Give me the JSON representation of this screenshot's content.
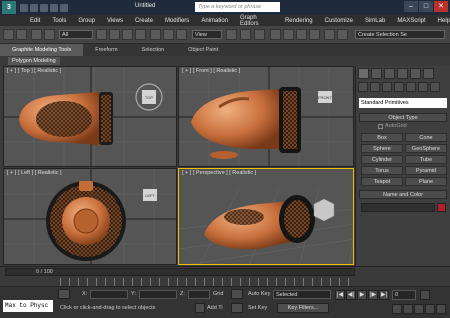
{
  "app": {
    "logo": "3",
    "title": "Untitled",
    "search_placeholder": "Type a keyword or phrase"
  },
  "menu": [
    "Edit",
    "Tools",
    "Group",
    "Views",
    "Create",
    "Modifiers",
    "Animation",
    "Graph Editors",
    "Rendering",
    "Customize",
    "SimLab",
    "MAXScript",
    "Help"
  ],
  "toolbar": {
    "selection_filter": "All",
    "view_dropdown": "View",
    "selection_set": "Create Selection Se"
  },
  "ribbon": {
    "tabs": [
      "Graphite Modeling Tools",
      "Freeform",
      "Selection",
      "Object Paint"
    ],
    "sub_label": "Polygon Modeling"
  },
  "viewports": {
    "top": "[ + ] [ Top ] [ Realistic ]",
    "front": "[ + ] [ Front ] [ Realistic ]",
    "left": "[ + ] [ Left ] [ Realistic ]",
    "perspective": "[ + ] [ Perspective ] [ Realistic ]",
    "viewcube_top": "TOP",
    "viewcube_front": "FRONT",
    "viewcube_left": "LEFT"
  },
  "command_panel": {
    "primitive_type": "Standard Primitives",
    "object_type_title": "Object Type",
    "autogrid": "AutoGrid",
    "objects": [
      "Box",
      "Cone",
      "Sphere",
      "GeoSphere",
      "Cylinder",
      "Tube",
      "Torus",
      "Pyramid",
      "Teapot",
      "Plane"
    ],
    "name_color_title": "Name and Color",
    "color": "#b4202a"
  },
  "timeline": {
    "frame_counter": "0 / 100"
  },
  "status": {
    "maxscript": "Max to Physc",
    "prompt": "Click or click-and-drag to select objects",
    "x_label": "X:",
    "y_label": "Y:",
    "z_label": "Z:",
    "grid_label": "Grid",
    "autokey": "Auto Key",
    "selected": "Selected",
    "set_key": "Set Key",
    "key_filters": "Key Filters...",
    "add_time_tag": "Add Ti",
    "frame_value": "0"
  }
}
